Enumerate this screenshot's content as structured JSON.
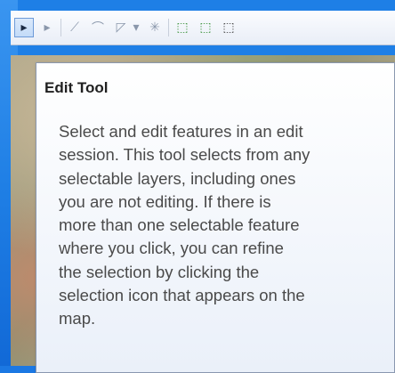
{
  "toolbar": {
    "icons": [
      {
        "name": "edit-tool-icon",
        "glyph": "▸",
        "active": true
      },
      {
        "name": "edit-annotation-tool-icon",
        "glyph": "▸",
        "active": false
      },
      {
        "name": "straight-segment-icon",
        "glyph": "⟋",
        "active": false
      },
      {
        "name": "end-point-arc-icon",
        "glyph": "⌒",
        "active": false
      },
      {
        "name": "construction-tools-icon",
        "glyph": "◸",
        "active": false
      },
      {
        "name": "construction-dropdown-icon",
        "glyph": "▾",
        "active": false
      },
      {
        "name": "cut-polygons-icon",
        "glyph": "✳",
        "active": false
      },
      {
        "name": "edit-vertices-icon",
        "glyph": "⬚",
        "active": false
      },
      {
        "name": "reshape-feature-icon",
        "glyph": "⬚",
        "active": false
      },
      {
        "name": "split-tool-icon",
        "glyph": "⬚",
        "active": false
      }
    ]
  },
  "tooltip": {
    "title": "Edit Tool",
    "body_lines": [
      "Select and edit features in an edit",
      "session. This tool selects from any",
      "selectable layers, including ones",
      "you are not editing. If there is",
      "more than one selectable feature",
      "where you click, you can refine",
      "the selection by clicking the",
      "selection icon that appears on the",
      "map."
    ]
  },
  "colors": {
    "frame": "#1e7fe6",
    "tooltip_title": "#202020",
    "tooltip_text": "#4a4a4a",
    "active_tool": "#c3dbf8"
  }
}
